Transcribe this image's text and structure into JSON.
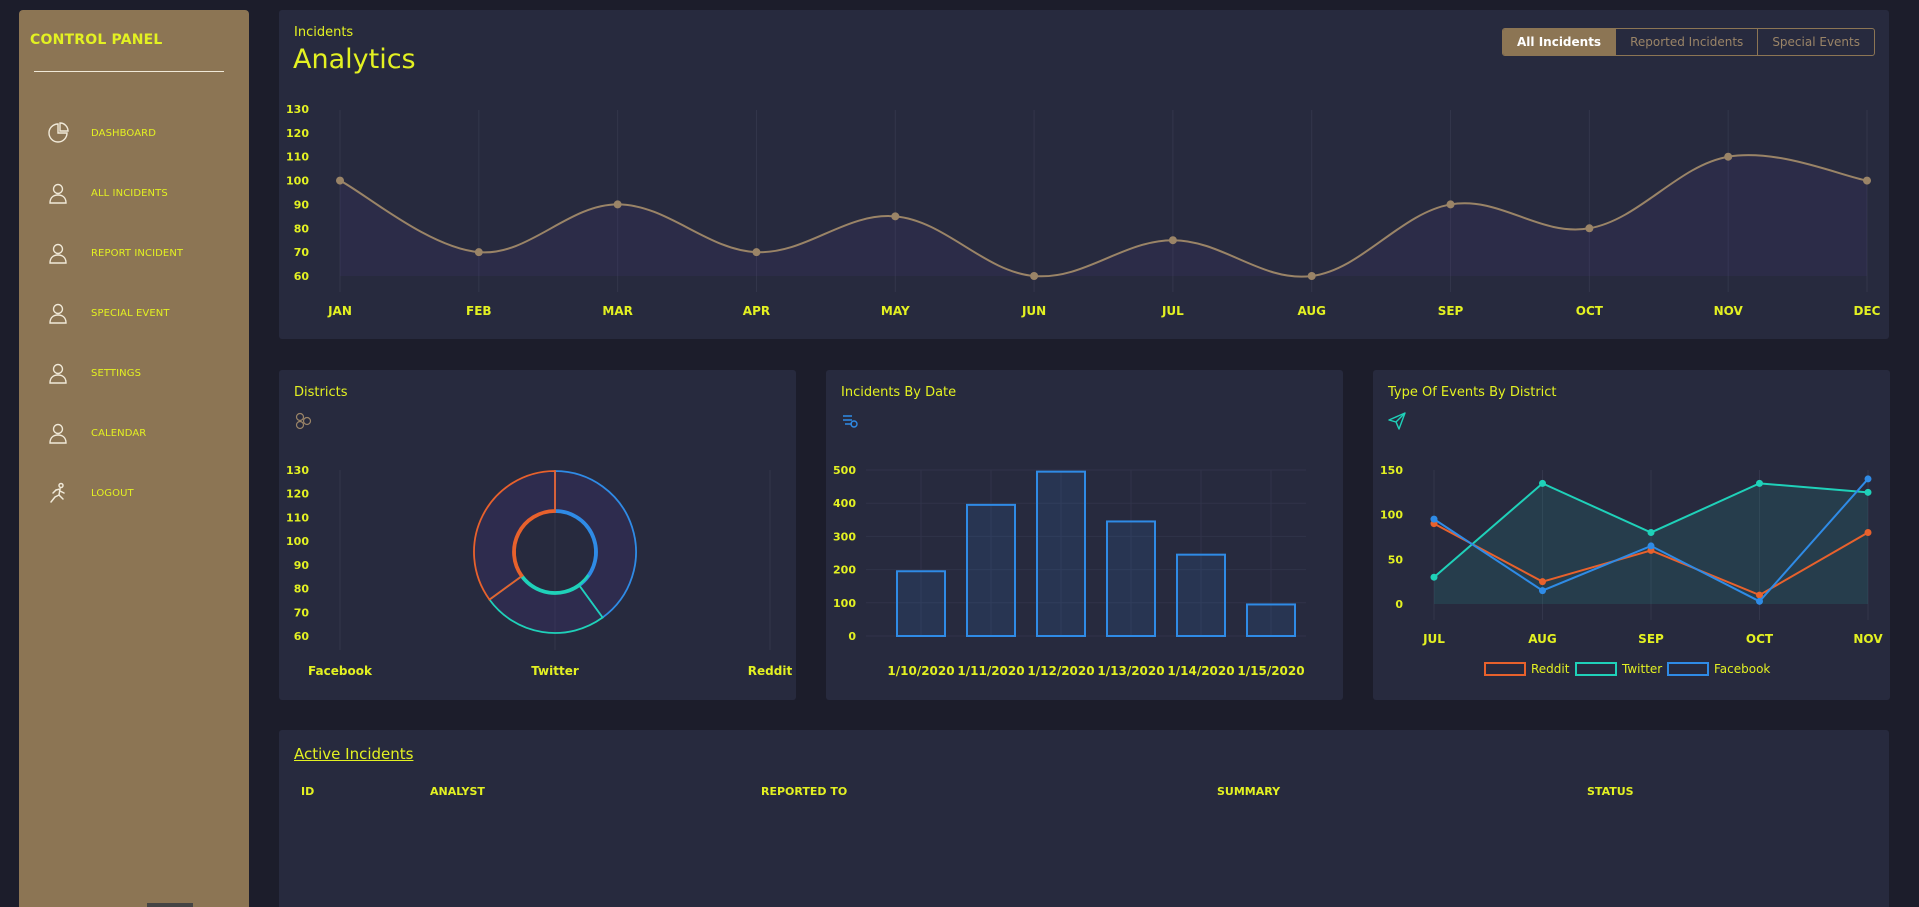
{
  "sidebar": {
    "title": "CONTROL PANEL",
    "items": [
      {
        "label": "DASHBOARD",
        "icon": "pie-chart-icon"
      },
      {
        "label": "ALL INCIDENTS",
        "icon": "user-icon"
      },
      {
        "label": "REPORT INCIDENT",
        "icon": "user-icon"
      },
      {
        "label": "SPECIAL EVENT",
        "icon": "user-icon"
      },
      {
        "label": "SETTINGS",
        "icon": "user-icon"
      },
      {
        "label": "CALENDAR",
        "icon": "user-icon"
      },
      {
        "label": "LOGOUT",
        "icon": "running-person-icon"
      }
    ]
  },
  "top": {
    "subtitle": "Incidents",
    "title": "Analytics",
    "filters": [
      {
        "label": "All Incidents",
        "active": true
      },
      {
        "label": "Reported Incidents",
        "active": false
      },
      {
        "label": "Special Events",
        "active": false
      }
    ]
  },
  "cards": {
    "districts": {
      "title": "Districts",
      "icon": "network-icon"
    },
    "bydate": {
      "title": "Incidents By Date",
      "icon": "list-icon"
    },
    "type": {
      "title": "Type Of Events By District",
      "icon": "send-icon"
    }
  },
  "table": {
    "title": "Active Incidents",
    "columns": [
      "ID",
      "ANALYST",
      "REPORTED TO",
      "SUMMARY",
      "STATUS"
    ]
  },
  "colors": {
    "accent": "#e3f122",
    "sidebar": "#8c7554",
    "card": "#272a3e",
    "line": "#9a8467",
    "reddit": "#e8612c",
    "twitter": "#1fd1b9",
    "facebook": "#2f8be6"
  },
  "chart_data": [
    {
      "type": "line",
      "categories": [
        "JAN",
        "FEB",
        "MAR",
        "APR",
        "MAY",
        "JUN",
        "JUL",
        "AUG",
        "SEP",
        "OCT",
        "NOV",
        "DEC"
      ],
      "values": [
        100,
        70,
        90,
        70,
        85,
        60,
        75,
        60,
        90,
        80,
        110,
        100
      ],
      "yticks": [
        60,
        70,
        80,
        90,
        100,
        110,
        120,
        130
      ],
      "ylim": [
        60,
        130
      ],
      "grid": "vertical"
    },
    {
      "type": "pie",
      "variant": "doughnut",
      "categories": [
        "Facebook",
        "Twitter",
        "Reddit"
      ],
      "slices": [
        {
          "label": "Facebook",
          "value": 40,
          "color": "#2f8be6"
        },
        {
          "label": "Twitter",
          "value": 25,
          "color": "#1fd1b9"
        },
        {
          "label": "Reddit",
          "value": 35,
          "color": "#e8612c"
        }
      ],
      "inner_slices": [
        {
          "label": "Facebook",
          "value": 35,
          "color": "#2f8be6"
        },
        {
          "label": "Twitter",
          "value": 30,
          "color": "#1fd1b9"
        },
        {
          "label": "Reddit",
          "value": 35,
          "color": "#e8612c"
        }
      ],
      "yticks": [
        60,
        70,
        80,
        90,
        100,
        110,
        120,
        130
      ]
    },
    {
      "type": "bar",
      "categories": [
        "1/10/2020",
        "1/11/2020",
        "1/12/2020",
        "1/13/2020",
        "1/14/2020",
        "1/15/2020"
      ],
      "values": [
        195,
        395,
        495,
        345,
        245,
        95
      ],
      "yticks": [
        0,
        100,
        200,
        300,
        400,
        500
      ],
      "ylim": [
        0,
        500
      ],
      "color": "#2f8be6"
    },
    {
      "type": "line",
      "categories": [
        "JUL",
        "AUG",
        "SEP",
        "OCT",
        "NOV"
      ],
      "series": [
        {
          "name": "Reddit",
          "values": [
            90,
            25,
            60,
            10,
            80
          ],
          "color": "#e8612c"
        },
        {
          "name": "Twitter",
          "values": [
            30,
            135,
            80,
            135,
            125
          ],
          "color": "#1fd1b9"
        },
        {
          "name": "Facebook",
          "values": [
            95,
            15,
            65,
            3,
            140
          ],
          "color": "#2f8be6"
        }
      ],
      "yticks": [
        0,
        50,
        100,
        150
      ],
      "ylim": [
        0,
        150
      ],
      "legend": "bottom"
    }
  ]
}
